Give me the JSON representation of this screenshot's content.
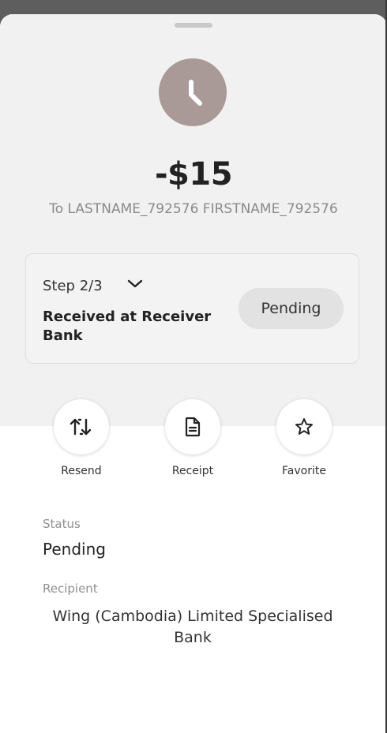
{
  "transaction": {
    "amount": "-$15",
    "to_line": "To LASTNAME_792576 FIRSTNAME_792576",
    "status_icon": "clock-icon"
  },
  "progress": {
    "step_label": "Step 2/3",
    "step_description": "Received at Receiver Bank",
    "status_pill": "Pending"
  },
  "actions": [
    {
      "label": "Resend",
      "icon": "resend-icon"
    },
    {
      "label": "Receipt",
      "icon": "receipt-icon"
    },
    {
      "label": "Favorite",
      "icon": "star-icon"
    }
  ],
  "details": {
    "status_label": "Status",
    "status_value": "Pending",
    "recipient_label": "Recipient",
    "recipient_value": "Wing (Cambodia) Limited Specialised Bank"
  },
  "colors": {
    "avatar_bg": "#a99a97",
    "top_panel_bg": "#f1f1f1",
    "pill_bg": "#e2e2e2"
  }
}
